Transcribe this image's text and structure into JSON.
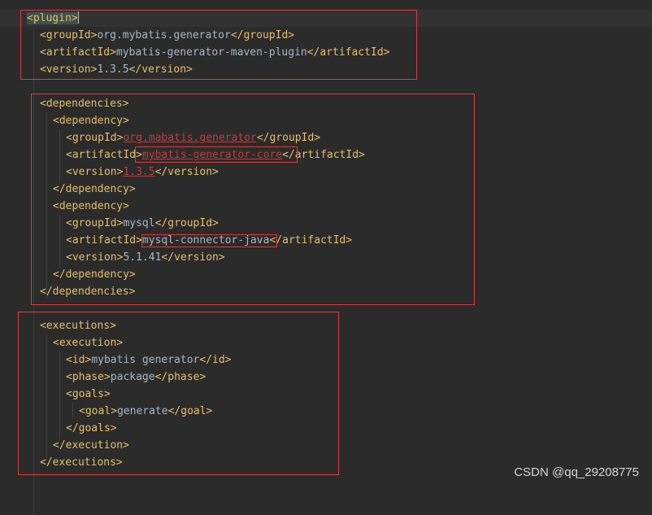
{
  "editor": {
    "lines": [
      {
        "parts": [
          {
            "t": "<plugin>",
            "c": "tag tagmatch"
          }
        ],
        "caret": true
      },
      {
        "parts": [
          {
            "t": "<groupId>",
            "c": "tag"
          },
          {
            "t": "org.mybatis.generator",
            "c": "txt"
          },
          {
            "t": "</groupId>",
            "c": "tag"
          }
        ]
      },
      {
        "parts": [
          {
            "t": "<artifactId>",
            "c": "tag"
          },
          {
            "t": "mybatis-generator-maven-plugin",
            "c": "txt"
          },
          {
            "t": "</artifactId>",
            "c": "tag"
          }
        ]
      },
      {
        "parts": [
          {
            "t": "<version>",
            "c": "tag"
          },
          {
            "t": "1.3.5",
            "c": "txt"
          },
          {
            "t": "</version>",
            "c": "tag"
          }
        ]
      },
      {
        "parts": []
      },
      {
        "parts": [
          {
            "t": "<dependencies>",
            "c": "tag"
          }
        ]
      },
      {
        "parts": [
          {
            "t": "<dependency>",
            "c": "tag"
          }
        ]
      },
      {
        "parts": [
          {
            "t": "<groupId>",
            "c": "tag"
          },
          {
            "t": "org.mabatis.generator",
            "c": "err"
          },
          {
            "t": "</groupId>",
            "c": "tag"
          }
        ]
      },
      {
        "parts": [
          {
            "t": "<artifactId>",
            "c": "tag"
          },
          {
            "t": "mybatis-generator-core",
            "c": "err"
          },
          {
            "t": "</artifactId>",
            "c": "tag"
          }
        ]
      },
      {
        "parts": [
          {
            "t": "<version>",
            "c": "tag"
          },
          {
            "t": "1.3.5",
            "c": "err"
          },
          {
            "t": "</version>",
            "c": "tag"
          }
        ]
      },
      {
        "parts": [
          {
            "t": "</dependency>",
            "c": "tag"
          }
        ]
      },
      {
        "parts": [
          {
            "t": "<dependency>",
            "c": "tag"
          }
        ]
      },
      {
        "parts": [
          {
            "t": "<groupId>",
            "c": "tag"
          },
          {
            "t": "mysql",
            "c": "txt"
          },
          {
            "t": "</groupId>",
            "c": "tag"
          }
        ]
      },
      {
        "parts": [
          {
            "t": "<artifactId>",
            "c": "tag"
          },
          {
            "t": "mysql-connector-java",
            "c": "txt"
          },
          {
            "t": "</artifactId>",
            "c": "tag"
          }
        ]
      },
      {
        "parts": [
          {
            "t": "<version>",
            "c": "tag"
          },
          {
            "t": "5.1.41",
            "c": "txt"
          },
          {
            "t": "</version>",
            "c": "tag"
          }
        ]
      },
      {
        "parts": [
          {
            "t": "</dependency>",
            "c": "tag"
          }
        ]
      },
      {
        "parts": [
          {
            "t": "</dependencies>",
            "c": "tag"
          }
        ]
      },
      {
        "parts": []
      },
      {
        "parts": [
          {
            "t": "<executions>",
            "c": "tag"
          }
        ]
      },
      {
        "parts": [
          {
            "t": "<execution>",
            "c": "tag"
          }
        ]
      },
      {
        "parts": [
          {
            "t": "<id>",
            "c": "tag"
          },
          {
            "t": "mybatis generator",
            "c": "txt"
          },
          {
            "t": "</id>",
            "c": "tag"
          }
        ]
      },
      {
        "parts": [
          {
            "t": "<phase>",
            "c": "tag"
          },
          {
            "t": "package",
            "c": "txt"
          },
          {
            "t": "</phase>",
            "c": "tag"
          }
        ]
      },
      {
        "parts": [
          {
            "t": "<goals>",
            "c": "tag"
          }
        ]
      },
      {
        "parts": [
          {
            "t": "<goal>",
            "c": "tag"
          },
          {
            "t": "generate",
            "c": "txt"
          },
          {
            "t": "</goal>",
            "c": "tag"
          }
        ]
      },
      {
        "parts": [
          {
            "t": "</goals>",
            "c": "tag"
          }
        ]
      },
      {
        "parts": [
          {
            "t": "</execution>",
            "c": "tag"
          }
        ]
      },
      {
        "parts": [
          {
            "t": "</executions>",
            "c": "tag"
          }
        ]
      }
    ]
  },
  "annotations": {
    "box_color": "#e03b3b"
  },
  "watermark": "CSDN @qq_29208775",
  "colors": {
    "background": "#2b2b2b",
    "tag": "#e8bf6a",
    "text": "#a9b7c6",
    "error": "#bc3f3c"
  }
}
